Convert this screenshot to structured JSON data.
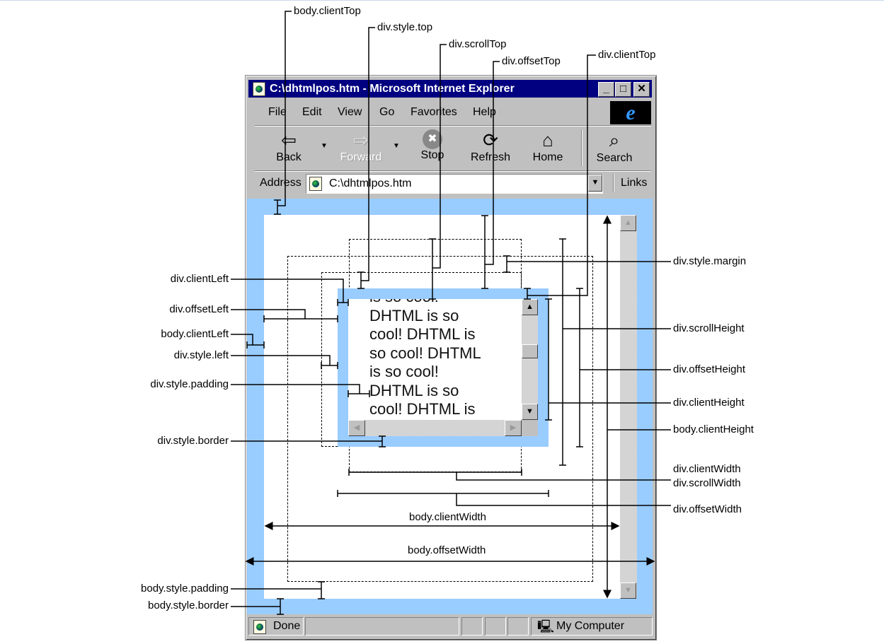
{
  "window": {
    "title": "C:\\dhtmlpos.htm - Microsoft Internet Explorer",
    "controls": [
      "_",
      "□",
      "✕"
    ],
    "menu": [
      {
        "label": "File"
      },
      {
        "label": "Edit"
      },
      {
        "label": "View"
      },
      {
        "label": "Go"
      },
      {
        "label": "Favorites"
      },
      {
        "label": "Help"
      }
    ],
    "toolbar": [
      {
        "label": "Back",
        "icon": "back-arrow-icon",
        "glyph": "⇦"
      },
      {
        "label": "Forward",
        "icon": "forward-arrow-icon",
        "glyph": "⇨",
        "disabled": true
      },
      {
        "label": "Stop",
        "icon": "stop-icon",
        "glyph": "✖"
      },
      {
        "label": "Refresh",
        "icon": "refresh-icon",
        "glyph": "⟳"
      },
      {
        "label": "Home",
        "icon": "home-icon",
        "glyph": "⌂"
      },
      {
        "label": "Search",
        "icon": "search-icon",
        "glyph": "⌕"
      }
    ],
    "address_label": "Address",
    "address_value": "C:\\dhtmlpos.htm",
    "links_label": "Links",
    "status": {
      "text": "Done",
      "zone": "My Computer"
    },
    "div_text_lines": [
      "is so cool!",
      "DHTML is so",
      "cool! DHTML is",
      "so cool! DHTML",
      "is so cool!",
      "DHTML is so",
      "cool! DHTML is"
    ]
  },
  "labels": {
    "top": [
      "body.clientTop",
      "div.style.top",
      "div.scrollTop",
      "div.offsetTop",
      "div.clientTop"
    ],
    "right": [
      "div.style.margin",
      "div.scrollHeight",
      "div.offsetHeight",
      "div.clientHeight",
      "body.clientHeight",
      "div.clientWidth",
      "div.scrollWidth",
      "div.offsetWidth"
    ],
    "left": [
      "div.clientLeft",
      "div.offsetLeft",
      "body.clientLeft",
      "div.style.left",
      "div.style.padding",
      "div.style.border",
      "body.style.padding",
      "body.style.border"
    ],
    "center": [
      "body.clientWidth",
      "body.offsetWidth"
    ]
  },
  "colors": {
    "title_bar": "#000080",
    "content_border": "#99ccff",
    "chrome": "#c0c0c0"
  }
}
